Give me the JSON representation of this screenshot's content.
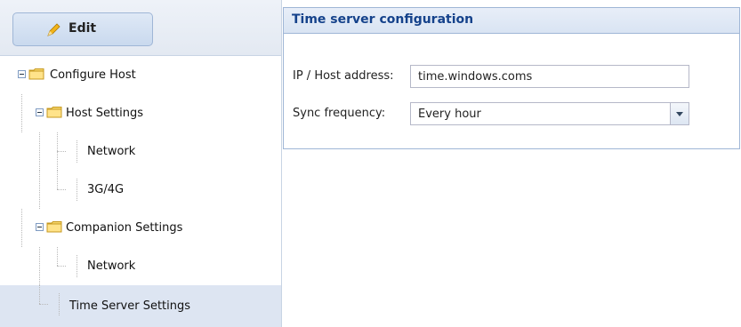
{
  "toolbar": {
    "edit_label": "Edit"
  },
  "tree": {
    "configure_host": "Configure Host",
    "host_settings": "Host Settings",
    "network_1": "Network",
    "cellular": "3G/4G",
    "companion_settings": "Companion Settings",
    "network_2": "Network",
    "time_server_settings": "Time Server Settings"
  },
  "panel": {
    "title": "Time server configuration",
    "ip_label": "IP / Host address:",
    "ip_value": "time.windows.coms",
    "sync_label": "Sync frequency:",
    "sync_value": "Every hour"
  },
  "colors": {
    "accent": "#15428b",
    "selection": "#dde5f2",
    "border": "#9fb6d6"
  },
  "icons": [
    "pencil-icon",
    "folder-icon",
    "collapse-icon",
    "chevron-down-icon"
  ]
}
